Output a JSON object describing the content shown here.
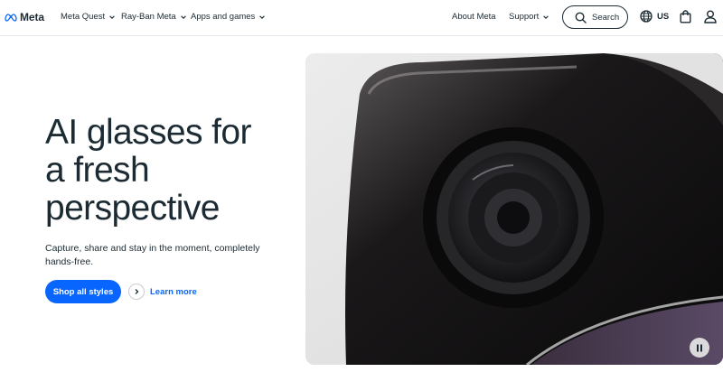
{
  "header": {
    "logo_text": "Meta",
    "nav": [
      {
        "label": "Meta Quest"
      },
      {
        "label": "Ray-Ban Meta"
      },
      {
        "label": "Apps and games"
      }
    ],
    "right_links": [
      {
        "label": "About Meta"
      },
      {
        "label": "Support"
      }
    ],
    "search_label": "Search",
    "region": "US"
  },
  "hero": {
    "title_lines": [
      "AI glasses for",
      "a fresh",
      "perspective"
    ],
    "subtitle": "Capture, share and stay in the moment, completely hands-free.",
    "primary_cta": "Shop all styles",
    "secondary_cta": "Learn more"
  },
  "colors": {
    "brand_blue": "#0866ff",
    "text": "#1c2b33"
  },
  "icons": {
    "logo": "meta-infinity-icon",
    "search": "search-icon",
    "globe": "globe-icon",
    "bag": "shopping-bag-icon",
    "user": "user-icon",
    "chevron": "chevron-down-icon",
    "arrow": "chevron-right-icon",
    "pause": "pause-icon"
  }
}
